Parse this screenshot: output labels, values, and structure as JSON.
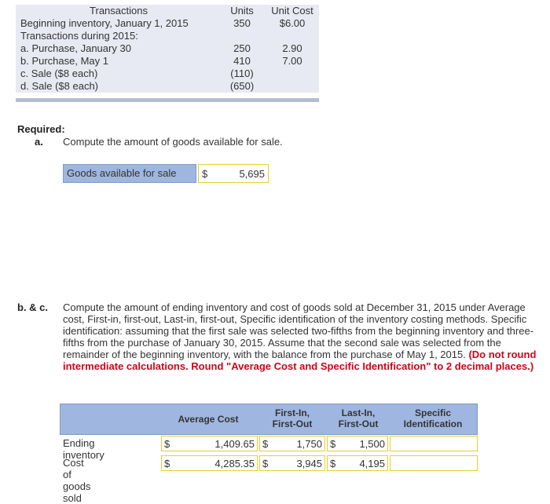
{
  "transactions": {
    "headers": [
      "Transactions",
      "Units",
      "Unit Cost"
    ],
    "rows": [
      {
        "label": "Beginning inventory, January 1, 2015",
        "units": "350",
        "cost": "$6.00"
      },
      {
        "label": "Transactions during 2015:",
        "units": "",
        "cost": ""
      },
      {
        "label": "a. Purchase, January 30",
        "units": "250",
        "cost": "2.90"
      },
      {
        "label": "b. Purchase, May 1",
        "units": "410",
        "cost": "7.00"
      },
      {
        "label": "c. Sale ($8 each)",
        "units": "(110)",
        "cost": ""
      },
      {
        "label": "d. Sale ($8 each)",
        "units": "(650)",
        "cost": ""
      }
    ]
  },
  "required": {
    "heading": "Required:",
    "a_label": "a.",
    "a_text": "Compute the amount of goods available for sale.",
    "goods_label": "Goods available for sale",
    "goods_dollar": "$",
    "goods_value": "5,695",
    "bc_label": "b. & c.",
    "bc_text": "Compute the amount of ending inventory and cost of goods sold at December 31, 2015 under Average cost, First-in, first-out, Last-in, first-out, Specific identification of the inventory costing methods. Specific identification: assuming that the first sale was selected two-fifths from the beginning inventory and three-fifths from the purchase of January 30, 2015. Assume that the second sale was selected from the remainder of the beginning inventory, with the balance from the purchase of May 1, 2015.",
    "bc_note": "(Do not round intermediate calculations. Round \"Average Cost and Specific Identification\" to 2 decimal places.)"
  },
  "results": {
    "headers": {
      "avg": "Average Cost",
      "fifo1": "First-In,",
      "fifo2": "First-Out",
      "lifo1": "Last-In,",
      "lifo2": "First-Out",
      "spec1": "Specific",
      "spec2": "Identification"
    },
    "rows": [
      {
        "label": "Ending inventory",
        "avg": "1,409.65",
        "fifo": "1,750",
        "lifo": "1,500",
        "spec": ""
      },
      {
        "label": "Cost of goods sold",
        "avg": "4,285.35",
        "fifo": "3,945",
        "lifo": "4,195",
        "spec": ""
      }
    ],
    "dollar": "$"
  }
}
